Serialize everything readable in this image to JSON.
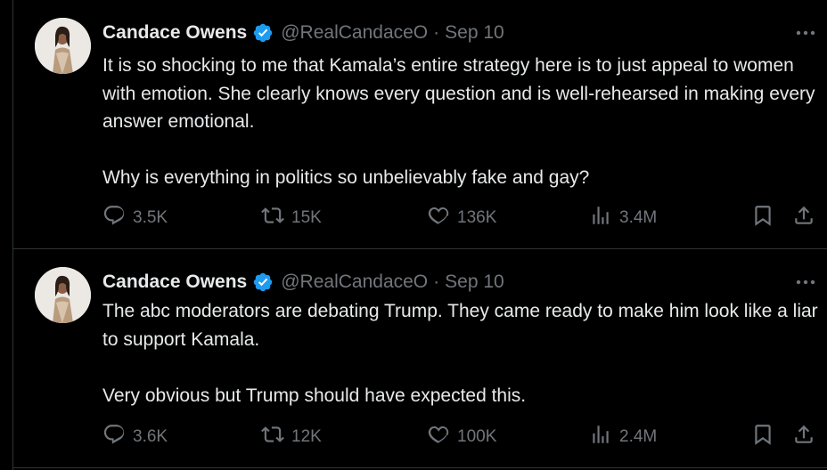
{
  "colors": {
    "background": "#000000",
    "text": "#e7e9ea",
    "muted": "#71767b",
    "verified": "#1d9bf0",
    "divider": "#2f3336"
  },
  "tweets": [
    {
      "name": "Candace Owens",
      "handle": "@RealCandaceO",
      "separator": "·",
      "date": "Sep 10",
      "paragraphs": [
        "It is so shocking to me that Kamala’s entire strategy here is to just appeal to women with emotion. She clearly knows every question and is well-rehearsed in making every answer emotional.",
        "Why is everything in politics so unbelievably fake and gay?"
      ],
      "replies": "3.5K",
      "reposts": "15K",
      "likes": "136K",
      "views": "3.4M"
    },
    {
      "name": "Candace Owens",
      "handle": "@RealCandaceO",
      "separator": "·",
      "date": "Sep 10",
      "paragraphs": [
        "The abc moderators are debating Trump. They came ready to make him look like a liar to support Kamala.",
        "Very obvious but Trump should have expected this."
      ],
      "replies": "3.6K",
      "reposts": "12K",
      "likes": "100K",
      "views": "2.4M"
    }
  ],
  "icons": {
    "verified": "verified-badge-icon",
    "more": "more-dots-icon",
    "reply": "reply-bubble-icon",
    "repost": "repost-arrows-icon",
    "like": "heart-icon",
    "views": "analytics-bars-icon",
    "bookmark": "bookmark-icon",
    "share": "share-upload-icon"
  }
}
